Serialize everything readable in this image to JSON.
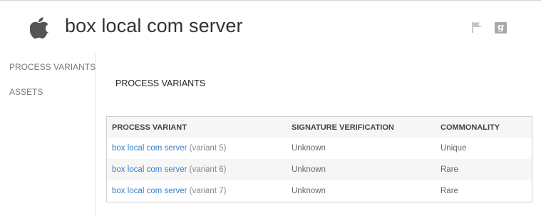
{
  "header": {
    "title": "box local com server",
    "logo_icon": "apple-logo-icon",
    "actions": [
      {
        "icon": "flag-icon"
      },
      {
        "icon": "google-plus-icon",
        "glyph": "g"
      }
    ]
  },
  "sidebar": {
    "items": [
      {
        "label": "PROCESS VARIANTS"
      },
      {
        "label": "ASSETS"
      }
    ]
  },
  "main": {
    "section_title": "PROCESS VARIANTS",
    "table": {
      "columns": [
        "PROCESS VARIANT",
        "SIGNATURE VERIFICATION",
        "COMMONALITY"
      ],
      "rows": [
        {
          "name": "box local com server",
          "suffix": "(variant 5)",
          "signature": "Unknown",
          "commonality": "Unique"
        },
        {
          "name": "box local com server",
          "suffix": "(variant 6)",
          "signature": "Unknown",
          "commonality": "Rare"
        },
        {
          "name": "box local com server",
          "suffix": "(variant 7)",
          "signature": "Unknown",
          "commonality": "Rare"
        }
      ]
    }
  },
  "colors": {
    "link": "#3d7fc6",
    "text": "#333333",
    "muted": "#7a7a7a",
    "row_alt": "#f6f6f6",
    "border": "#cfcfcf"
  }
}
